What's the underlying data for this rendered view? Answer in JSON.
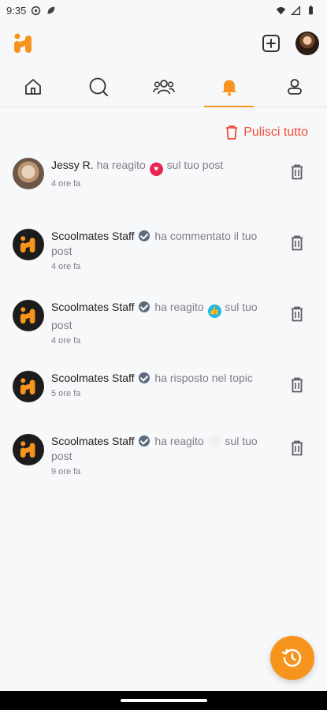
{
  "status_bar": {
    "time": "9:35"
  },
  "header": {
    "logo": "scoolmates-logo",
    "add_icon": "plus-square-icon"
  },
  "tabs": [
    {
      "name": "home",
      "icon": "home-icon",
      "active": false
    },
    {
      "name": "search",
      "icon": "search-icon",
      "active": false
    },
    {
      "name": "groups",
      "icon": "people-icon",
      "active": false
    },
    {
      "name": "notifications",
      "icon": "bell-icon",
      "active": true
    },
    {
      "name": "profile",
      "icon": "user-icon",
      "active": false
    }
  ],
  "clear_all_label": "Pulisci tutto",
  "notifications": [
    {
      "name": "Jessy R.",
      "verified": false,
      "action": "ha reagito",
      "reaction": "heart",
      "rest": "sul tuo post",
      "time": "4 ore fa"
    },
    {
      "name": "Scoolmates Staff",
      "verified": true,
      "action": "ha commentato il tuo post",
      "reaction": "",
      "rest": "",
      "time": "4 ore fa"
    },
    {
      "name": "Scoolmates Staff",
      "verified": true,
      "action": "ha reagito",
      "reaction": "like",
      "rest": "sul tuo post",
      "time": "4 ore fa"
    },
    {
      "name": "Scoolmates Staff",
      "verified": true,
      "action": "ha risposto nel topic",
      "reaction": "",
      "rest": "",
      "time": "5 ore fa"
    },
    {
      "name": "Scoolmates Staff",
      "verified": true,
      "action": "ha reagito",
      "reaction": "blank",
      "rest": "sul tuo post",
      "time": "9 ore fa"
    }
  ],
  "colors": {
    "accent": "#f7941d",
    "danger": "#ef4b3c",
    "muted": "#7d7f86"
  }
}
